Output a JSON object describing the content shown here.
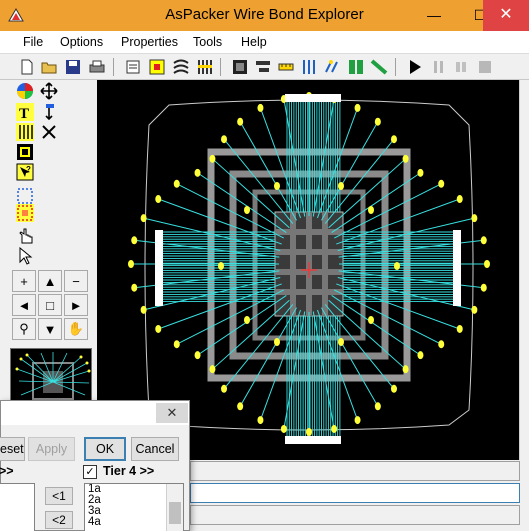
{
  "window": {
    "title": "AsPacker Wire Bond Explorer",
    "minimize_glyph": "—",
    "maximize_glyph": "☐",
    "close_glyph": "✕"
  },
  "menu": [
    "File",
    "Options",
    "Properties",
    "Tools",
    "Help"
  ],
  "toolbar_icons": [
    "new-file-icon",
    "open-folder-icon",
    "save-icon",
    "print-icon",
    "properties-icon",
    "component-icon",
    "wire-icon",
    "bond-finger-icon",
    "select-die-icon",
    "align-icon",
    "measure-icon",
    "wire-spacing-icon",
    "bondpad-icon",
    "ring-icon",
    "route-icon",
    "play-icon",
    "pause-icon",
    "step-icon",
    "stop-icon"
  ],
  "left_tools": [
    "color-wheel-icon",
    "move-cross-icon",
    "text-tool-icon",
    "move-vertical-icon",
    "wire-stack-icon",
    "delete-x-icon",
    "select-die-icon",
    "help-select-icon",
    "select-rect-icon",
    "select-region-icon",
    "hand-pointer-icon",
    "arrow-pointer-icon"
  ],
  "nav": {
    "zoom_in": "+",
    "up": "▲",
    "zoom_out": "−",
    "left": "◄",
    "center": "□",
    "right": "►",
    "zoom_tool": "⚲",
    "down": "▼",
    "pan": "✋"
  },
  "colors": {
    "title_bar": "#eea030",
    "wire": "#38e0e0",
    "finger": "#ffff3a",
    "ring": "#9a9a9a",
    "die": "#6a6a6a",
    "center_mark": "#ff3030"
  },
  "dialog": {
    "close_glyph": "✕",
    "reset_partial": "eset",
    "apply": "Apply",
    "ok": "OK",
    "cancel": "Cancel",
    "left_tier_partial": ">>",
    "right_tier_label": "Tier 4 >>",
    "right_tier_checked": "✓",
    "move_left_1": "<1",
    "move_left_2": "<2",
    "right_list": [
      "1a",
      "2a",
      "3a",
      "4a"
    ]
  }
}
